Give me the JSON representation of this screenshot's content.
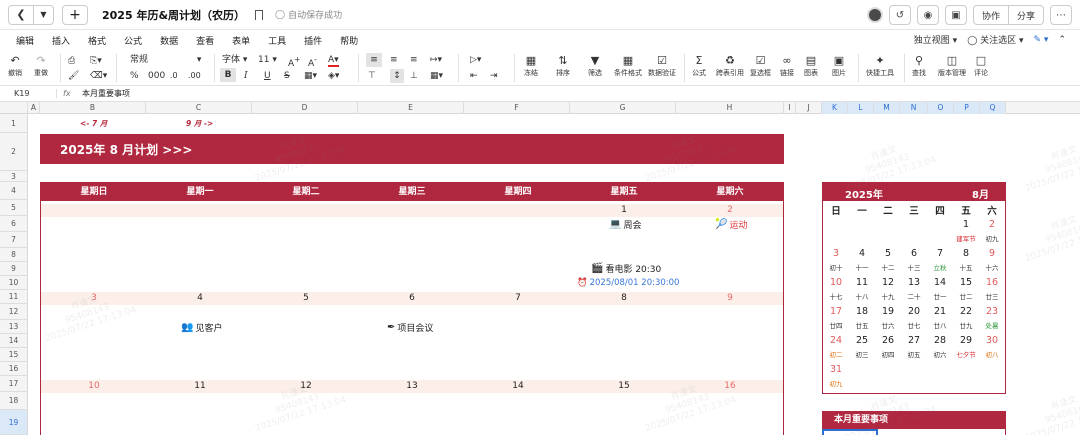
{
  "titlebar": {
    "doc_title": "2025 年历&周计划（农历）",
    "save_status": "自动保存成功",
    "collab": "协作",
    "share": "分享"
  },
  "menu": {
    "items": [
      "编辑",
      "插入",
      "格式",
      "公式",
      "数据",
      "查看",
      "表单",
      "工具",
      "插件",
      "帮助"
    ],
    "view_mode": "独立视图",
    "focus": "关注选区"
  },
  "toolbar": {
    "undo": "撤销",
    "redo": "重做",
    "number_format": "常规",
    "font": "字体",
    "font_size": "11",
    "percent": "%",
    "thousands": "000",
    "dec_add": ".0",
    "dec_sub": ".00",
    "freeze": "冻结",
    "sort": "排序",
    "filter": "筛选",
    "cond_format": "条件格式",
    "validation": "数据验证",
    "formula": "公式",
    "cross_ref": "跨表引用",
    "checkbox": "复选框",
    "link": "链接",
    "chart": "图表",
    "image": "图片",
    "quick_tools": "快捷工具",
    "find": "查找",
    "version": "版本管理",
    "comment": "评论"
  },
  "formula_bar": {
    "cell_ref": "K19",
    "fx": "fx",
    "content": "本月重要事项"
  },
  "columns": [
    "A",
    "B",
    "C",
    "D",
    "E",
    "F",
    "G",
    "H",
    "I",
    "J",
    "K",
    "L",
    "M",
    "N",
    "O",
    "P",
    "Q"
  ],
  "rows": [
    "1",
    "2",
    "3",
    "4",
    "5",
    "6",
    "7",
    "8",
    "9",
    "10",
    "11",
    "12",
    "13",
    "14",
    "15",
    "16",
    "17",
    "18",
    "19"
  ],
  "sheet": {
    "prev_month": "<- 7 月",
    "next_month": "9 月 ->",
    "banner": "2025年 8 月计划 >>>",
    "weekdays": [
      "星期日",
      "星期一",
      "星期二",
      "星期三",
      "星期四",
      "星期五",
      "星期六"
    ],
    "week1": [
      "",
      "",
      "",
      "",
      "",
      "1",
      "2"
    ],
    "week2": [
      "3",
      "4",
      "5",
      "6",
      "7",
      "8",
      "9"
    ],
    "week3": [
      "10",
      "11",
      "12",
      "13",
      "14",
      "15",
      "16"
    ],
    "events": {
      "meeting": "周会",
      "sport": "运动",
      "movie": "看电影 20:30",
      "movie_time": "2025/08/01 20:30:00",
      "client": "见客户",
      "project": "项目会议"
    }
  },
  "mini_calendar": {
    "year": "2025年",
    "month": "8月",
    "weekdays": [
      "日",
      "一",
      "二",
      "三",
      "四",
      "五",
      "六"
    ],
    "weeks": [
      {
        "days": [
          "",
          "",
          "",
          "",
          "",
          "1",
          "2"
        ],
        "lunar": [
          "",
          "",
          "",
          "",
          "",
          "建军节",
          "初九"
        ]
      },
      {
        "days": [
          "3",
          "4",
          "5",
          "6",
          "7",
          "8",
          "9"
        ],
        "lunar": [
          "初十",
          "十一",
          "十二",
          "十三",
          "立秋",
          "十五",
          "十六"
        ]
      },
      {
        "days": [
          "10",
          "11",
          "12",
          "13",
          "14",
          "15",
          "16"
        ],
        "lunar": [
          "十七",
          "十八",
          "十九",
          "二十",
          "廿一",
          "廿二",
          "廿三"
        ]
      },
      {
        "days": [
          "17",
          "18",
          "19",
          "20",
          "21",
          "22",
          "23"
        ],
        "lunar": [
          "廿四",
          "廿五",
          "廿六",
          "廿七",
          "廿八",
          "廿九",
          "处暑"
        ]
      },
      {
        "days": [
          "24",
          "25",
          "26",
          "27",
          "28",
          "29",
          "30"
        ],
        "lunar": [
          "初二",
          "初三",
          "初四",
          "初五",
          "初六",
          "七夕节",
          "初八"
        ]
      },
      {
        "days": [
          "31",
          "",
          "",
          "",
          "",
          "",
          ""
        ],
        "lunar": [
          "初九",
          "",
          "",
          "",
          "",
          "",
          ""
        ]
      }
    ],
    "notes_title": "本月重要事项"
  },
  "watermark": {
    "name": "肖逢文",
    "id": "95408143",
    "time": "2025/07/22 17:13:04"
  },
  "colors": {
    "accent": "#b0283f",
    "strip": "#fcefe9",
    "weekend": "#e66b6b",
    "selection": "#2b6fd3"
  }
}
